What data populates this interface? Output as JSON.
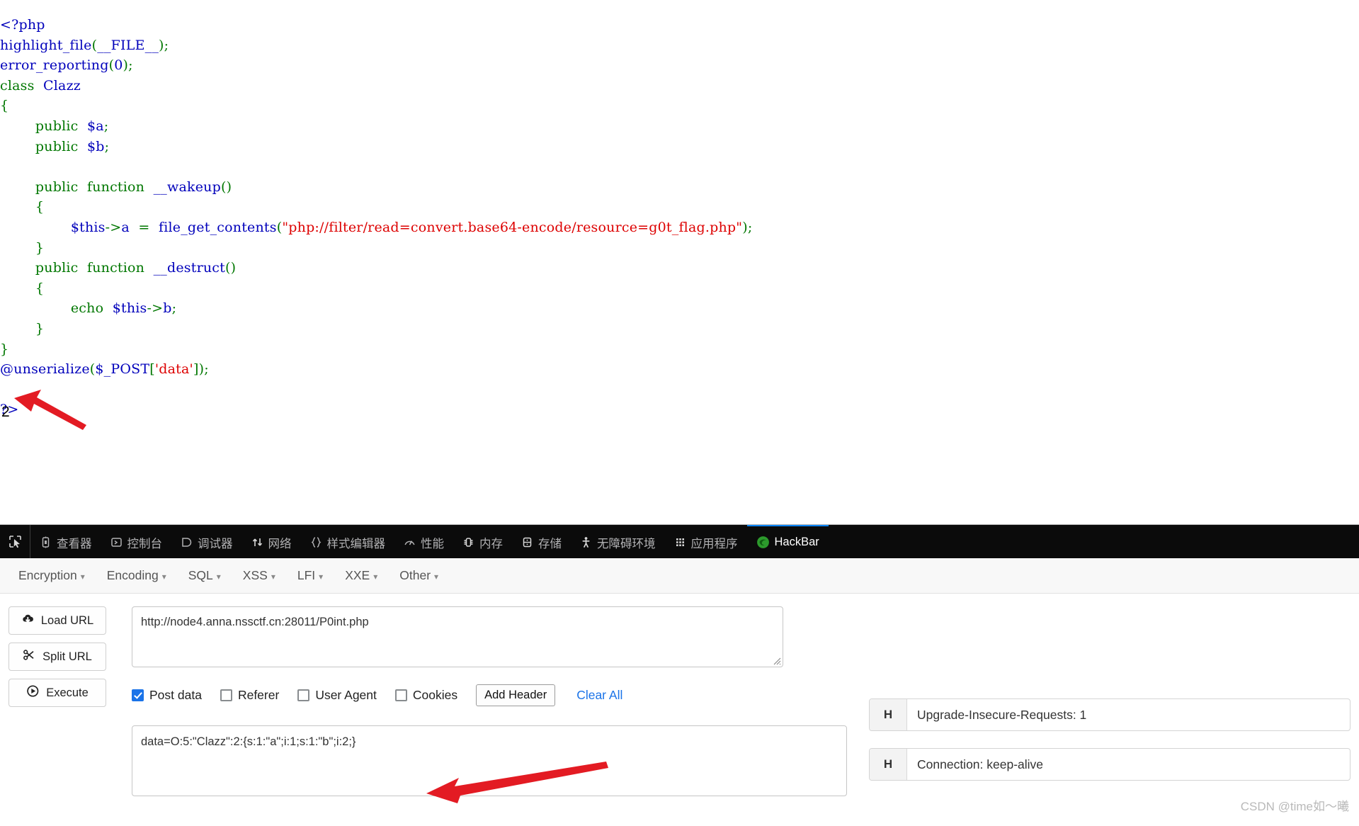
{
  "page": {
    "code_lines": [
      [
        {
          "t": "<?php",
          "c": "def"
        }
      ],
      [
        {
          "t": "highlight_file",
          "c": "def"
        },
        {
          "t": "(",
          "c": "pun"
        },
        {
          "t": "__FILE__",
          "c": "def"
        },
        {
          "t": ")",
          "c": "pun"
        },
        {
          "t": ";",
          "c": "pun"
        }
      ],
      [
        {
          "t": "error_reporting",
          "c": "def"
        },
        {
          "t": "(",
          "c": "pun"
        },
        {
          "t": "0",
          "c": "def"
        },
        {
          "t": ")",
          "c": "pun"
        },
        {
          "t": ";",
          "c": "pun"
        }
      ],
      [
        {
          "t": "class",
          "c": "kw"
        },
        {
          "t": "  ",
          "c": "pun"
        },
        {
          "t": "Clazz",
          "c": "cls"
        }
      ],
      [
        {
          "t": "{",
          "c": "kw"
        }
      ],
      [
        {
          "t": "        ",
          "c": "pun"
        },
        {
          "t": "public",
          "c": "kw"
        },
        {
          "t": "  ",
          "c": "pun"
        },
        {
          "t": "$a",
          "c": "def"
        },
        {
          "t": ";",
          "c": "kw"
        }
      ],
      [
        {
          "t": "        ",
          "c": "pun"
        },
        {
          "t": "public",
          "c": "kw"
        },
        {
          "t": "  ",
          "c": "pun"
        },
        {
          "t": "$b",
          "c": "def"
        },
        {
          "t": ";",
          "c": "kw"
        }
      ],
      [
        {
          "t": "",
          "c": "pun"
        }
      ],
      [
        {
          "t": "        ",
          "c": "pun"
        },
        {
          "t": "public",
          "c": "kw"
        },
        {
          "t": "  ",
          "c": "pun"
        },
        {
          "t": "function",
          "c": "kw"
        },
        {
          "t": "  ",
          "c": "pun"
        },
        {
          "t": "__wakeup",
          "c": "def"
        },
        {
          "t": "()",
          "c": "kw"
        }
      ],
      [
        {
          "t": "        {",
          "c": "kw"
        }
      ],
      [
        {
          "t": "                ",
          "c": "pun"
        },
        {
          "t": "$this",
          "c": "def"
        },
        {
          "t": "->",
          "c": "kw"
        },
        {
          "t": "a",
          "c": "def"
        },
        {
          "t": "  =  ",
          "c": "kw"
        },
        {
          "t": "file_get_contents",
          "c": "def"
        },
        {
          "t": "(",
          "c": "kw"
        },
        {
          "t": "\"php://filter/read=convert.base64-encode/resource=g0t_flag.php\"",
          "c": "str"
        },
        {
          "t": ")",
          "c": "kw"
        },
        {
          "t": ";",
          "c": "kw"
        }
      ],
      [
        {
          "t": "        }",
          "c": "kw"
        }
      ],
      [
        {
          "t": "        ",
          "c": "pun"
        },
        {
          "t": "public",
          "c": "kw"
        },
        {
          "t": "  ",
          "c": "pun"
        },
        {
          "t": "function",
          "c": "kw"
        },
        {
          "t": "  ",
          "c": "pun"
        },
        {
          "t": "__destruct",
          "c": "def"
        },
        {
          "t": "()",
          "c": "kw"
        }
      ],
      [
        {
          "t": "        {",
          "c": "kw"
        }
      ],
      [
        {
          "t": "                ",
          "c": "pun"
        },
        {
          "t": "echo",
          "c": "kw"
        },
        {
          "t": "  ",
          "c": "pun"
        },
        {
          "t": "$this",
          "c": "def"
        },
        {
          "t": "->",
          "c": "kw"
        },
        {
          "t": "b",
          "c": "def"
        },
        {
          "t": ";",
          "c": "kw"
        }
      ],
      [
        {
          "t": "        }",
          "c": "kw"
        }
      ],
      [
        {
          "t": "}",
          "c": "kw"
        }
      ],
      [
        {
          "t": "@unserialize",
          "c": "def"
        },
        {
          "t": "(",
          "c": "kw"
        },
        {
          "t": "$_POST",
          "c": "def"
        },
        {
          "t": "[",
          "c": "kw"
        },
        {
          "t": "'data'",
          "c": "str"
        },
        {
          "t": "]",
          "c": "kw"
        },
        {
          "t": ")",
          "c": "kw"
        },
        {
          "t": ";",
          "c": "kw"
        }
      ],
      [
        {
          "t": "",
          "c": "pun"
        }
      ],
      [
        {
          "t": "?>",
          "c": "def"
        }
      ]
    ],
    "output": "2"
  },
  "devtools": {
    "picker_icon": "element-picker-icon",
    "tabs": [
      {
        "label": "查看器",
        "icon": "inspector-icon",
        "active": false
      },
      {
        "label": "控制台",
        "icon": "console-icon",
        "active": false
      },
      {
        "label": "调试器",
        "icon": "debugger-icon",
        "active": false
      },
      {
        "label": "网络",
        "icon": "network-icon",
        "active": false
      },
      {
        "label": "样式编辑器",
        "icon": "style-editor-icon",
        "active": false
      },
      {
        "label": "性能",
        "icon": "performance-icon",
        "active": false
      },
      {
        "label": "内存",
        "icon": "memory-icon",
        "active": false
      },
      {
        "label": "存储",
        "icon": "storage-icon",
        "active": false
      },
      {
        "label": "无障碍环境",
        "icon": "accessibility-icon",
        "active": false
      },
      {
        "label": "应用程序",
        "icon": "application-icon",
        "active": false
      },
      {
        "label": "HackBar",
        "icon": "hackbar-icon",
        "active": true
      }
    ],
    "active_tab_accent": "#0a84ff"
  },
  "hackbar": {
    "menus": [
      {
        "label": "Encryption"
      },
      {
        "label": "Encoding"
      },
      {
        "label": "SQL"
      },
      {
        "label": "XSS"
      },
      {
        "label": "LFI"
      },
      {
        "label": "XXE"
      },
      {
        "label": "Other"
      }
    ],
    "caret": "▾",
    "buttons": [
      {
        "label": "Load URL",
        "icon": "cloud-download-icon"
      },
      {
        "label": "Split URL",
        "icon": "scissors-icon"
      },
      {
        "label": "Execute",
        "icon": "play-icon"
      }
    ],
    "url": {
      "value": "http://node4.anna.nssctf.cn:28011/P0int.php",
      "placeholder": ""
    },
    "checkboxes": [
      {
        "label": "Post data",
        "checked": true
      },
      {
        "label": "Referer",
        "checked": false
      },
      {
        "label": "User Agent",
        "checked": false
      },
      {
        "label": "Cookies",
        "checked": false
      }
    ],
    "add_header_label": "Add Header",
    "clear_all_label": "Clear All",
    "post_data": {
      "value": "data=O:5:\"Clazz\":2:{s:1:\"a\";i:1;s:1:\"b\";i:2;}",
      "placeholder": ""
    },
    "headers": [
      {
        "tag": "H",
        "value": "Upgrade-Insecure-Requests: 1"
      },
      {
        "tag": "H",
        "value": "Connection: keep-alive"
      }
    ],
    "accent_link_color": "#1a73e8",
    "checkbox_checked_color": "#1a73e8"
  },
  "annotations": {
    "arrow_color": "#e31b23",
    "arrows": [
      {
        "name": "arrow-to-output"
      },
      {
        "name": "arrow-to-post-data"
      }
    ],
    "watermark": "CSDN @time如～曦"
  }
}
